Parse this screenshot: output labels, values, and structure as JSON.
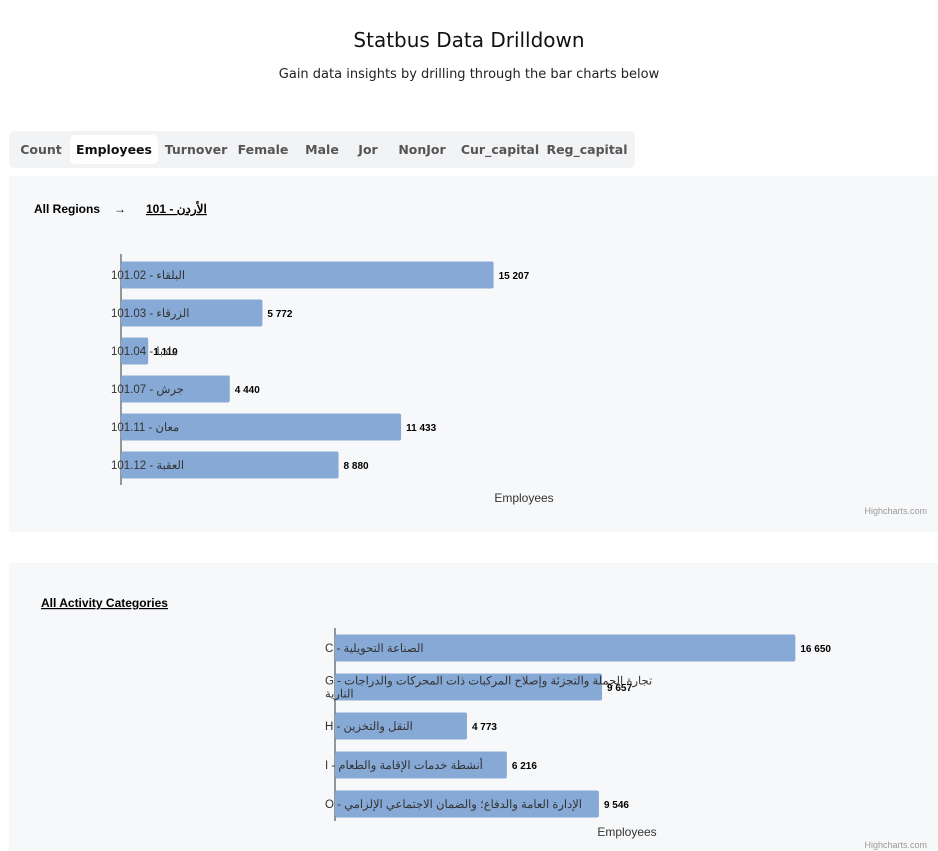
{
  "header": {
    "title": "Statbus Data Drilldown",
    "subtitle": "Gain data insights by drilling through the bar charts below"
  },
  "tabs": [
    {
      "label": "Count",
      "active": false
    },
    {
      "label": "Employees",
      "active": true
    },
    {
      "label": "Turnover",
      "active": false
    },
    {
      "label": "Female",
      "active": false
    },
    {
      "label": "Male",
      "active": false
    },
    {
      "label": "Jor",
      "active": false
    },
    {
      "label": "NonJor",
      "active": false
    },
    {
      "label": "Cur_capital",
      "active": false
    },
    {
      "label": "Reg_capital",
      "active": false
    }
  ],
  "colors": {
    "bar": "#87a9d5",
    "panel_bg": "#f7f8fa"
  },
  "chart_data": [
    {
      "type": "bar",
      "orientation": "horizontal",
      "breadcrumb": {
        "root": "All Regions",
        "arrow": "→",
        "current": "الأردن - 101"
      },
      "categories": [
        "البلقاء - 101.02",
        "الزرقاء - 101.03",
        "مادبا - 101.04",
        "جرش - 101.07",
        "معان - 101.11",
        "العقبة - 101.12"
      ],
      "values": [
        15207,
        5772,
        1110,
        4440,
        11433,
        8880
      ],
      "data_labels": [
        "15 207",
        "5 772",
        "1 110",
        "4 440",
        "11 433",
        "8 880"
      ],
      "xlabel": "Employees",
      "xlim": [
        0,
        40000
      ],
      "credit": "Highcharts.com",
      "grid": false,
      "legend": "none"
    },
    {
      "type": "bar",
      "orientation": "horizontal",
      "breadcrumb": {
        "root": "All Activity Categories"
      },
      "categories": [
        "الصناعة التحويلية - C",
        "تجارة الجملة والتجزئة وإصلاح المركبات ذات المحركات والدراجات الناریة - G",
        "النقل والتخزين - H",
        "أنشطة خدمات الإقامة والطعام - I",
        "الإدارة العامة والدفاع؛ والضمان الاجتماعي الإلزامي - O"
      ],
      "values": [
        16650,
        9657,
        4773,
        6216,
        9546
      ],
      "data_labels": [
        "16 650",
        "9 657",
        "4 773",
        "6 216",
        "9 546"
      ],
      "xlabel": "Employees",
      "xlim": [
        0,
        20000
      ],
      "credit": "Highcharts.com",
      "grid": false,
      "legend": "none"
    }
  ]
}
